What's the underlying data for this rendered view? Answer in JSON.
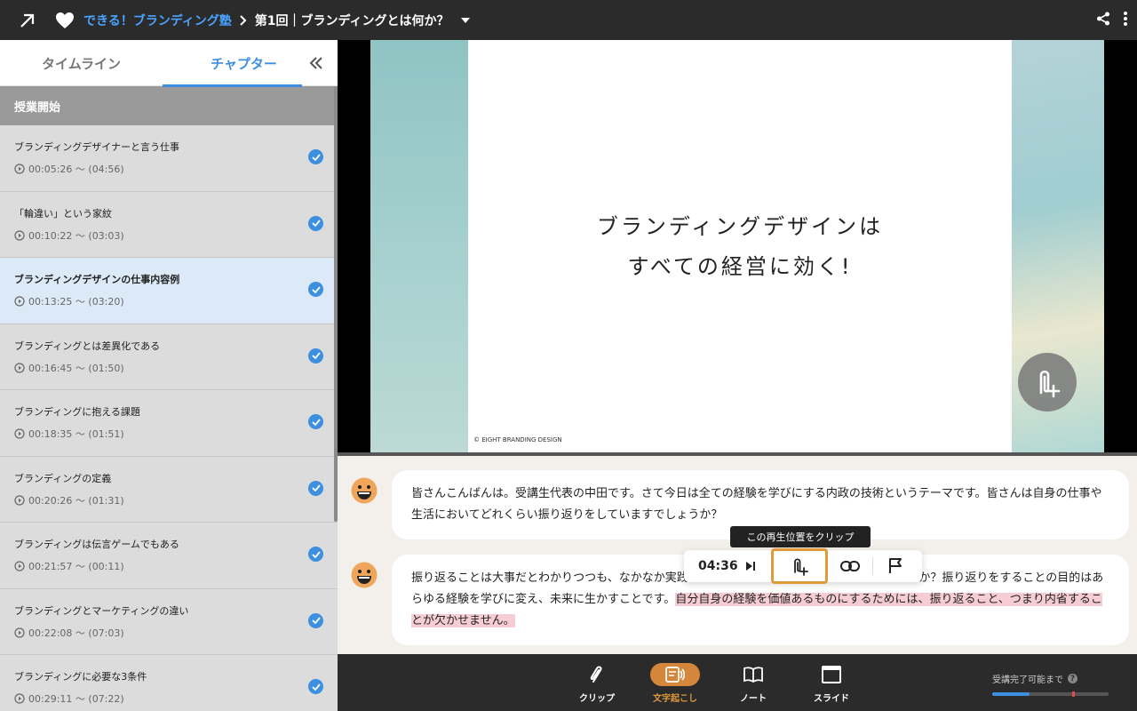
{
  "header": {
    "course_title": "できる！ブランディング塾",
    "lesson_title": "第1回｜ブランディングとは何か？"
  },
  "sidebar": {
    "tabs": [
      {
        "label": "タイムライン",
        "active": false
      },
      {
        "label": "チャプター",
        "active": true
      }
    ],
    "section_header": "授業開始",
    "chapters": [
      {
        "title": "ブランディングデザイナーと言う仕事",
        "time": "00:05:26 〜 (04:56)",
        "done": true,
        "active": false
      },
      {
        "title": "「輪違い」という家紋",
        "time": "00:10:22 〜 (03:03)",
        "done": true,
        "active": false
      },
      {
        "title": "ブランディングデザインの仕事内容例",
        "time": "00:13:25 〜 (03:20)",
        "done": true,
        "active": true
      },
      {
        "title": "ブランディングとは差異化である",
        "time": "00:16:45 〜 (01:50)",
        "done": true,
        "active": false
      },
      {
        "title": "ブランディングに抱える課題",
        "time": "00:18:35 〜 (01:51)",
        "done": true,
        "active": false
      },
      {
        "title": "ブランディングの定義",
        "time": "00:20:26 〜 (01:31)",
        "done": true,
        "active": false
      },
      {
        "title": "ブランディングは伝言ゲームでもある",
        "time": "00:21:57 〜 (00:11)",
        "done": true,
        "active": false
      },
      {
        "title": "ブランディングとマーケティングの違い",
        "time": "00:22:08 〜 (07:03)",
        "done": true,
        "active": false
      },
      {
        "title": "ブランディングに必要な3条件",
        "time": "00:29:11 〜 (07:22)",
        "done": true,
        "active": false
      }
    ]
  },
  "video": {
    "slide_line1": "ブランディングデザインは",
    "slide_line2": "すべての経営に効く!",
    "slide_copyright": "© EIGHT BRANDING DESIGN"
  },
  "transcript": {
    "messages": [
      {
        "text": "皆さんこんばんは。受講生代表の中田です。さて今日は全ての経験を学びにする内政の技術というテーマです。皆さんは自身の仕事や生活においてどれくらい振り返りをしていますでしょうか？"
      },
      {
        "text": "振り返ることは大事だとわかりつつも、なかなか実践できないという人も多いのではないでしょうか？振り返りをすることの目的はあらゆる経験を学びに変え、未来に生かすことです。",
        "highlight": "自分自身の経験を価値あるものにするためには、振り返ること、つまり内省することが欠かせません。"
      }
    ]
  },
  "clip_toolbar": {
    "time": "04:36",
    "tooltip": "この再生位置をクリップ"
  },
  "bottom_nav": {
    "items": [
      {
        "label": "クリップ",
        "active": false
      },
      {
        "label": "文字起こし",
        "active": true
      },
      {
        "label": "ノート",
        "active": false
      },
      {
        "label": "スライド",
        "active": false
      }
    ],
    "completion_label": "受講完了可能まで",
    "completion_progress": 0.32,
    "completion_threshold": 0.69
  },
  "colors": {
    "accent_blue": "#3d8fe0",
    "accent_orange": "#e09a3a",
    "highlight_pink": "#f6cdd4",
    "bar_dark": "#2b2b2b"
  }
}
